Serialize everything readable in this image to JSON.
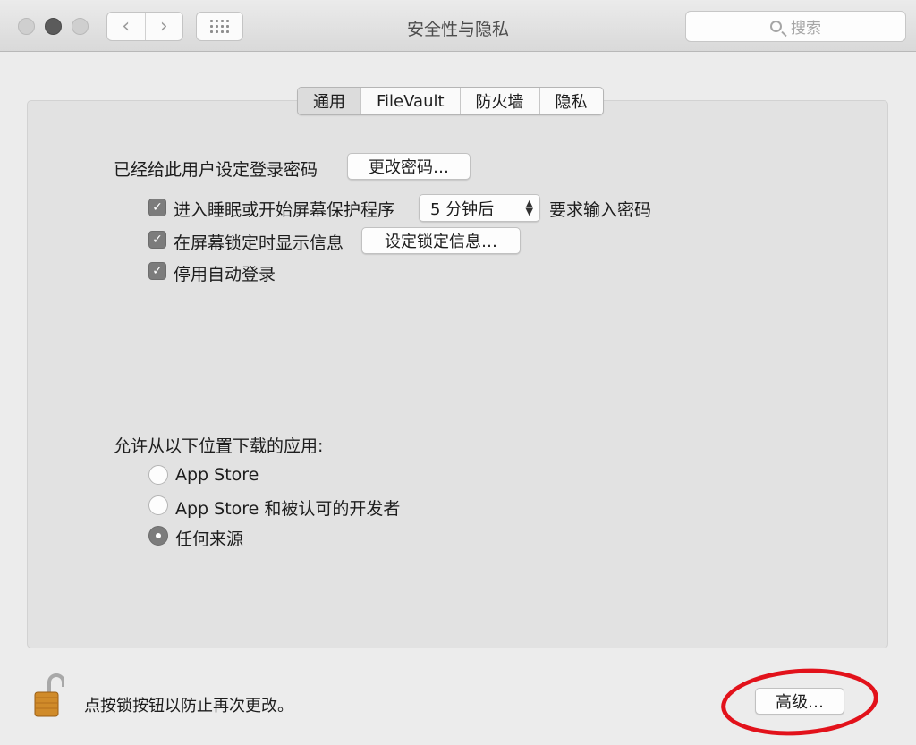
{
  "window": {
    "title": "安全性与隐私"
  },
  "toolbar": {
    "back_label": "‹",
    "forward_label": "›",
    "search_placeholder": "搜索"
  },
  "tabs": [
    {
      "label": "通用",
      "active": true
    },
    {
      "label": "FileVault",
      "active": false
    },
    {
      "label": "防火墙",
      "active": false
    },
    {
      "label": "隐私",
      "active": false
    }
  ],
  "general": {
    "password_label": "已经给此用户设定登录密码",
    "change_password_button": "更改密码…",
    "require_password": {
      "checked": true,
      "label": "进入睡眠或开始屏幕保护程序",
      "select_value": "5 分钟后",
      "suffix": "要求输入密码"
    },
    "show_message": {
      "checked": true,
      "label": "在屏幕锁定时显示信息",
      "button": "设定锁定信息…"
    },
    "disable_autologin": {
      "checked": true,
      "label": "停用自动登录"
    }
  },
  "downloads": {
    "heading": "允许从以下位置下载的应用:",
    "options": [
      {
        "label": "App Store",
        "selected": false
      },
      {
        "label": "App Store 和被认可的开发者",
        "selected": false
      },
      {
        "label": "任何来源",
        "selected": true
      }
    ]
  },
  "footer": {
    "lock_text": "点按锁按钮以防止再次更改。",
    "advanced_button": "高级…"
  },
  "colors": {
    "annotation": "#e2121b",
    "lock": "#d08b2a"
  }
}
